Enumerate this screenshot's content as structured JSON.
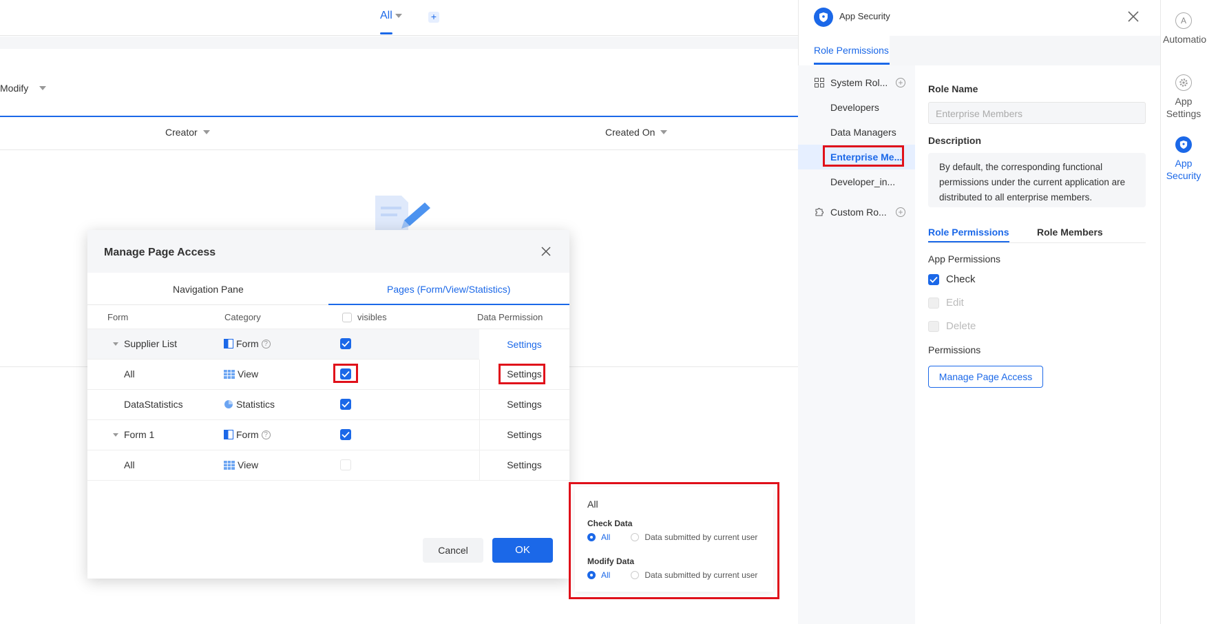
{
  "background": {
    "view_tab": "All",
    "add_tab": "+",
    "modify_label": "Modify",
    "columns": [
      "Creator",
      "Created On"
    ]
  },
  "panel": {
    "title": "App Security",
    "tab": "Role Permissions",
    "tree": {
      "system_roles": "System Rol...",
      "roles": [
        "Developers",
        "Data Managers",
        "Enterprise Me...",
        "Developer_in..."
      ],
      "custom_roles": "Custom Ro..."
    },
    "role_name_label": "Role Name",
    "role_name_placeholder": "Enterprise Members",
    "description_label": "Description",
    "description_text": "By default, the corresponding functional permissions under the current application are distributed to all enterprise members.",
    "subtabs": [
      "Role Permissions",
      "Role Members"
    ],
    "app_permissions_label": "App Permissions",
    "perms": [
      {
        "label": "Check",
        "checked": true
      },
      {
        "label": "Edit",
        "checked": false
      },
      {
        "label": "Delete",
        "checked": false
      }
    ],
    "permissions_label": "Permissions",
    "manage_button": "Manage Page Access"
  },
  "rail": {
    "items": [
      {
        "label": "Automation",
        "icon": "automation-icon"
      },
      {
        "label": "App Settings",
        "icon": "gear-icon"
      },
      {
        "label": "App Security",
        "icon": "shield-icon"
      }
    ]
  },
  "modal": {
    "title": "Manage Page Access",
    "tabs": [
      "Navigation Pane",
      "Pages (Form/View/Statistics)"
    ],
    "headers": {
      "form": "Form",
      "category": "Category",
      "visibles": "visibles",
      "data_permission": "Data Permission"
    },
    "rows": [
      {
        "name": "Supplier List",
        "category": "Form",
        "visible": true,
        "settings": "Settings"
      },
      {
        "name": "All",
        "category": "View",
        "visible": true,
        "settings": "Settings"
      },
      {
        "name": "DataStatistics",
        "category": "Statistics",
        "visible": true,
        "settings": "Settings"
      },
      {
        "name": "Form 1",
        "category": "Form",
        "visible": true,
        "settings": "Settings"
      },
      {
        "name": "All",
        "category": "View",
        "visible": false,
        "settings": "Settings"
      }
    ],
    "cancel": "Cancel",
    "ok": "OK"
  },
  "popup": {
    "title": "All",
    "check_data_label": "Check Data",
    "modify_data_label": "Modify Data",
    "opt_all": "All",
    "opt_current": "Data submitted by current user"
  },
  "colors": {
    "accent": "#1b68e8",
    "highlight": "#e0101a"
  }
}
